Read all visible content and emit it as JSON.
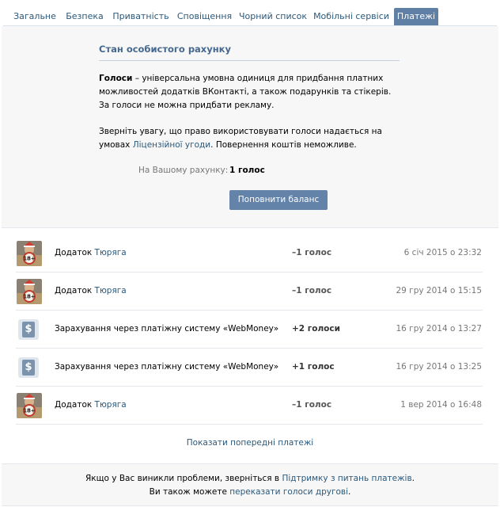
{
  "tabs": [
    {
      "label": "Загальне",
      "active": false
    },
    {
      "label": "Безпека",
      "active": false
    },
    {
      "label": "Приватність",
      "active": false
    },
    {
      "label": "Сповіщення",
      "active": false
    },
    {
      "label": "Чорний список",
      "active": false
    },
    {
      "label": "Мобільні сервіси",
      "active": false
    },
    {
      "label": "Платежі",
      "active": true
    }
  ],
  "account": {
    "title": "Стан особистого рахунку",
    "p1_bold": "Голоси",
    "p1_rest": " – універсальна умовна одиниця для придбання платних можливостей додатків ВКонтакті, а також подарунків та стікерів. За голоси не можна придбати рекламу.",
    "p2_before": "Зверніть увагу, що право використовувати голоси надається на умовах ",
    "p2_link": "Ліцензійної угоди",
    "p2_after": ". Повернення коштів неможливе.",
    "balance_label": "На Вашому рахунку:",
    "balance_value": "1 голос",
    "topup_label": "Поповнити баланс"
  },
  "transactions": [
    {
      "icon": "app-avatar",
      "prefix": "Додаток ",
      "link": "Тюряга",
      "amount": "–1 голос",
      "date": "6 січ 2015 о 23:32"
    },
    {
      "icon": "app-avatar",
      "prefix": "Додаток ",
      "link": "Тюряга",
      "amount": "–1 голос",
      "date": "29 гру 2014 о 15:15"
    },
    {
      "icon": "dollar-icon",
      "prefix": "Зарахування через платіжну систему «WebMoney»",
      "link": "",
      "amount": "+2 голоси",
      "date": "16 гру 2014 о 13:27"
    },
    {
      "icon": "dollar-icon",
      "prefix": "Зарахування через платіжну систему «WebMoney»",
      "link": "",
      "amount": "+1 голос",
      "date": "16 гру 2014 о 13:25"
    },
    {
      "icon": "app-avatar",
      "prefix": "Додаток ",
      "link": "Тюряга",
      "amount": "–1 голос",
      "date": "1 вер 2014 о 16:48"
    }
  ],
  "show_prev_label": "Показати попередні платежі",
  "footer": {
    "line1_before": "Якщо у Вас виникли проблеми, зверніться в ",
    "line1_link": "Підтримку з питань платежів",
    "line1_after": ".",
    "line2_before": "Ви також можете ",
    "line2_link": "переказати голоси другові",
    "line2_after": "."
  },
  "colors": {
    "link": "#2b587a",
    "tab_active_bg": "#5f7fa4",
    "button_bg": "#6383a8",
    "panel_bg": "#f7f7f7"
  }
}
